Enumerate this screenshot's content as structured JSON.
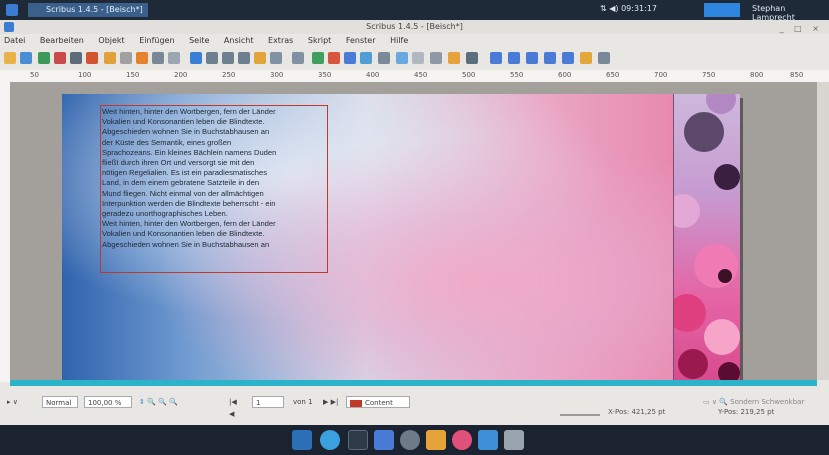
{
  "system_bar": {
    "app_task": "Scribus 1.4.5 - [Beisch*]",
    "tray_time": "09:31:17",
    "user": "Stephan Lamprecht"
  },
  "window": {
    "title": "Scribus 1.4.5 - [Beisch*]",
    "controls": "_ □ ×"
  },
  "menu": [
    "Datei",
    "Bearbeiten",
    "Objekt",
    "Einfügen",
    "Seite",
    "Ansicht",
    "Extras",
    "Skript",
    "Fenster",
    "Hilfe"
  ],
  "ruler": {
    "ticks": [
      "50",
      "100",
      "150",
      "200",
      "250",
      "300",
      "350",
      "400",
      "450",
      "500",
      "550",
      "600",
      "650",
      "700",
      "750",
      "800",
      "850",
      "900"
    ]
  },
  "document": {
    "text": "Weit hinten, hinter den Wortbergen, fern der Länder\nVokalien und Konsonantien leben die Blindtexte.\nAbgeschieden wohnen Sie in Buchstabhausen an\nder Küste des Semantik, eines großen\nSprachozeans. Ein kleines Bächlein namens Duden\nfließt durch ihren Ort und versorgt sie mit den\nnötigen Regelialien. Es ist ein paradiesmatisches\nLand, in dem einem gebratene Satzteile in den\nMund fliegen. Nicht einmal von der allmächtigen\nInterpunktion werden die Blindtexte beherrscht - ein\ngeradezu unorthographisches Leben.\nWeit hinten, hinter den Wortbergen, fern der Länder\nVokalien und Konsonantien leben die Blindtexte.\nAbgeschieden wohnen Sie in Buchstabhausen an"
  },
  "status": {
    "mode": "Normal",
    "zoom": "100,00 %",
    "page": "1",
    "page_of": "von 1",
    "layer": "Content",
    "units_label": "Sondern Schwenkbar",
    "xpos": "X-Pos: 421,25 pt",
    "ypos": "Y-Pos: 219,25 pt"
  },
  "colors": {
    "accent": "#2ab3c9",
    "frame": "#c0392b"
  }
}
